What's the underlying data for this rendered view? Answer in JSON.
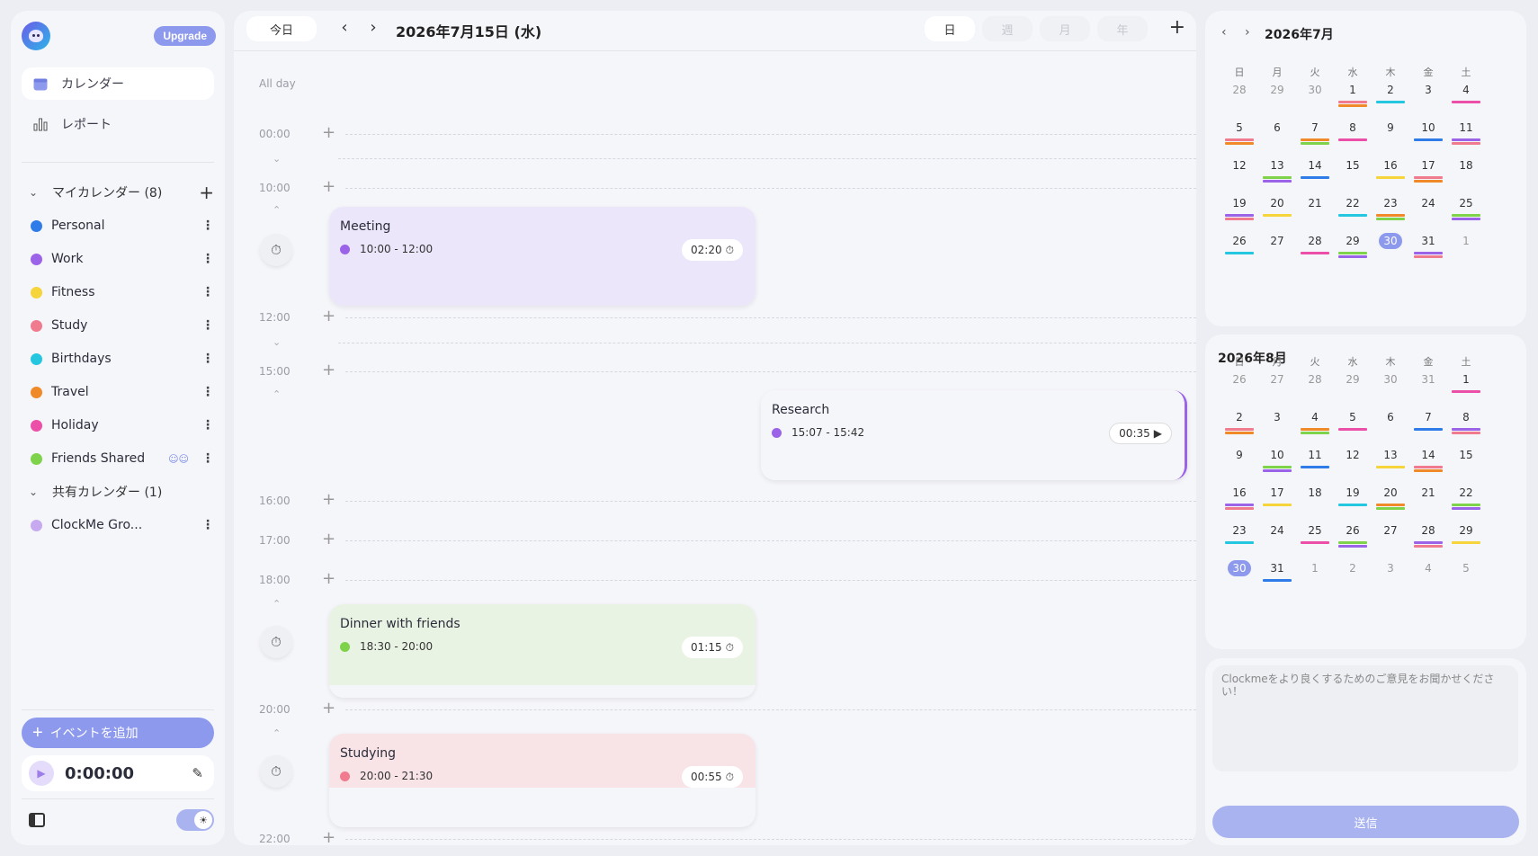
{
  "sidebar": {
    "upgrade_label": "Upgrade",
    "nav": [
      {
        "label": "カレンダー",
        "icon": "calendar-icon",
        "active": true
      },
      {
        "label": "レポート",
        "icon": "bar-chart-icon",
        "active": false
      }
    ],
    "my_calendars_label": "マイカレンダー (8)",
    "shared_calendars_label": "共有カレンダー (1)",
    "calendars": [
      {
        "name": "Personal",
        "color": "#2f7ce8"
      },
      {
        "name": "Work",
        "color": "#9b63e8"
      },
      {
        "name": "Fitness",
        "color": "#f5d43c"
      },
      {
        "name": "Study",
        "color": "#f07a8e"
      },
      {
        "name": "Birthdays",
        "color": "#25c6e0"
      },
      {
        "name": "Travel",
        "color": "#f08a28"
      },
      {
        "name": "Holiday",
        "color": "#ec4fa8"
      },
      {
        "name": "Friends Shared",
        "color": "#7fd34a",
        "shared": true
      }
    ],
    "shared_calendars": [
      {
        "name": "ClockMe Gro...",
        "color": "#c7a9f0"
      }
    ],
    "add_event_label": "イベントを追加",
    "timer_value": "0:00:00"
  },
  "header": {
    "today_label": "今日",
    "date_title": "2026年7月15日 (水)",
    "views": [
      "日",
      "週",
      "月",
      "年"
    ],
    "active_view": "日"
  },
  "timeline": {
    "allday_label": "All day",
    "times": [
      "00:00",
      "10:00",
      "12:00",
      "15:00",
      "16:00",
      "17:00",
      "18:00",
      "20:00",
      "22:00"
    ],
    "events": [
      {
        "title": "Meeting",
        "time": "10:00 - 12:00",
        "duration": "02:20",
        "color": "#9b63e8",
        "bg": "#ece6fa"
      },
      {
        "title": "Research",
        "time": "15:07 - 15:42",
        "duration": "00:35",
        "color": "#9b63e8",
        "bg": "#f5f6fa"
      },
      {
        "title": "Dinner with friends",
        "time": "18:30 - 20:00",
        "duration": "01:15",
        "color": "#7fd34a",
        "bg": "#e9f3e4"
      },
      {
        "title": "Studying",
        "time": "20:00 - 21:30",
        "duration": "00:55",
        "color": "#f07a8e",
        "bg": "#f8e3e7"
      }
    ]
  },
  "july": {
    "title": "2026年7月",
    "weekdays": [
      "日",
      "月",
      "火",
      "水",
      "木",
      "金",
      "土"
    ],
    "weeks": [
      [
        "28",
        "29",
        "30",
        "1",
        "2",
        "3",
        "4"
      ],
      [
        "5",
        "6",
        "7",
        "8",
        "9",
        "10",
        "11"
      ],
      [
        "12",
        "13",
        "14",
        "15",
        "16",
        "17",
        "18"
      ],
      [
        "19",
        "20",
        "21",
        "22",
        "23",
        "24",
        "25"
      ],
      [
        "26",
        "27",
        "28",
        "29",
        "30",
        "31",
        "1"
      ]
    ],
    "selected": "30"
  },
  "august": {
    "title": "2026年8月",
    "weekdays": [
      "日",
      "月",
      "火",
      "水",
      "木",
      "金",
      "土"
    ],
    "weeks": [
      [
        "26",
        "27",
        "28",
        "29",
        "30",
        "31",
        "1"
      ],
      [
        "2",
        "3",
        "4",
        "5",
        "6",
        "7",
        "8"
      ],
      [
        "9",
        "10",
        "11",
        "12",
        "13",
        "14",
        "15"
      ],
      [
        "16",
        "17",
        "18",
        "19",
        "20",
        "21",
        "22"
      ],
      [
        "23",
        "24",
        "25",
        "26",
        "27",
        "28",
        "29"
      ],
      [
        "30",
        "31",
        "1",
        "2",
        "3",
        "4",
        "5"
      ]
    ],
    "selected": "30"
  },
  "feedback": {
    "placeholder": "Clockmeをより良くするためのご意見をお聞かせください！",
    "send_label": "送信"
  }
}
